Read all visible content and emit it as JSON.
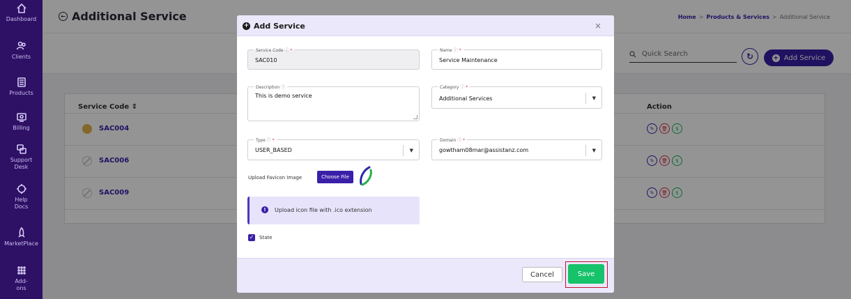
{
  "sidebar": {
    "items": [
      {
        "label": "Dashboard",
        "icon": "home-icon"
      },
      {
        "label": "Clients",
        "icon": "users-icon"
      },
      {
        "label": "Products",
        "icon": "box-icon"
      },
      {
        "label": "Billing",
        "icon": "billing-icon"
      },
      {
        "label": "Support Desk",
        "icon": "support-icon"
      },
      {
        "label": "Help Docs",
        "icon": "help-icon"
      },
      {
        "label": "MarketPlace",
        "icon": "rocket-icon"
      },
      {
        "label": "Add-ons",
        "icon": "grid-icon"
      }
    ]
  },
  "page": {
    "title": "Additional Service",
    "breadcrumb": [
      "Home",
      "Products & Services",
      "Additional Service"
    ],
    "search_placeholder": "Quick Search",
    "add_button": "Add Service"
  },
  "table": {
    "headers": [
      "Service Code",
      "Action"
    ],
    "rows": [
      {
        "code": "SAC004",
        "status": "active"
      },
      {
        "code": "SAC006",
        "status": "disabled"
      },
      {
        "code": "SAC009",
        "status": "disabled"
      }
    ]
  },
  "modal": {
    "title": "Add Service",
    "close": "×",
    "fields": {
      "service_code": {
        "label": "Service Code",
        "value": "SAC010"
      },
      "name": {
        "label": "Name",
        "value": "Service Maintenance"
      },
      "description": {
        "label": "Description",
        "value": "This is demo service"
      },
      "category": {
        "label": "Category",
        "value": "Additional Services"
      },
      "type": {
        "label": "Type",
        "value": "USER_BASED"
      },
      "domain": {
        "label": "Domain",
        "value": "gowtham08mar@assistanz.com"
      }
    },
    "upload_label": "Upload Favicon Image",
    "choose_file": "Choose File",
    "info_text": "Upload icon file with .ico extension",
    "state_label": "State",
    "cancel": "Cancel",
    "save": "Save"
  },
  "colors": {
    "sidebar": "#2e1065",
    "primary": "#3a1fa8",
    "success": "#16c26a",
    "danger": "#d6304a",
    "highlight": "#c8102e"
  }
}
